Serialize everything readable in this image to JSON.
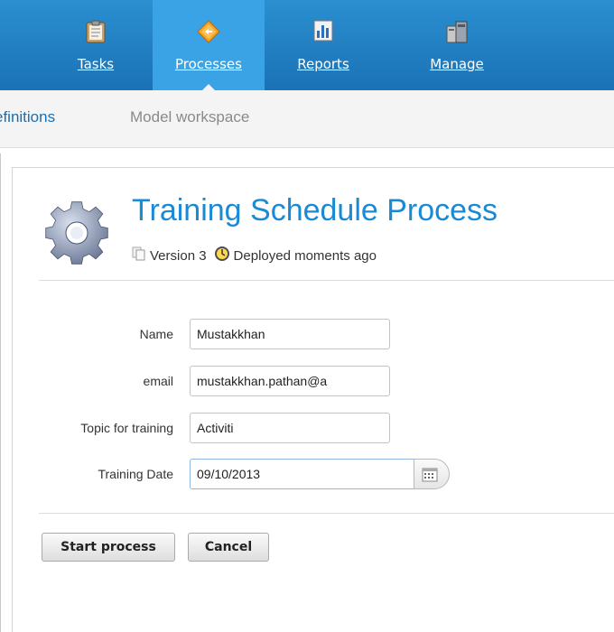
{
  "nav": {
    "items": [
      {
        "label": "Tasks",
        "icon": "clipboard-icon"
      },
      {
        "label": "Processes",
        "icon": "diamond-process-icon"
      },
      {
        "label": "Reports",
        "icon": "bar-chart-icon"
      },
      {
        "label": "Manage",
        "icon": "server-icon"
      }
    ],
    "active": "Processes"
  },
  "subnav": {
    "definitions_label": "efinitions",
    "model_workspace_label": "Model workspace"
  },
  "process": {
    "title": "Training Schedule Process",
    "version": "Version 3",
    "deployed": "Deployed moments ago"
  },
  "form": {
    "name": {
      "label": "Name",
      "value": "Mustakkhan"
    },
    "email": {
      "label": "email",
      "value": "mustakkhan.pathan@a"
    },
    "topic": {
      "label": "Topic for training",
      "value": "Activiti"
    },
    "date": {
      "label": "Training Date",
      "value": "09/10/2013"
    }
  },
  "buttons": {
    "start": "Start process",
    "cancel": "Cancel"
  },
  "colors": {
    "nav_bg": "#1b72b6",
    "nav_active": "#3aa3e6",
    "title": "#1a8ad4"
  }
}
